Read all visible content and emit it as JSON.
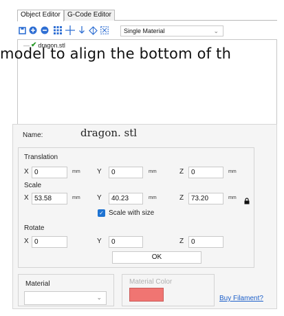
{
  "tabs": [
    {
      "label": "Object Editor",
      "active": true
    },
    {
      "label": "G-Code Editor",
      "active": false
    }
  ],
  "toolbar": {
    "icons": [
      "print-icon",
      "add-icon",
      "remove-icon",
      "grid-icon",
      "move-icon",
      "drop-icon",
      "mirror-icon",
      "split-icon"
    ],
    "material_mode": "Single Material"
  },
  "object_list": {
    "items": [
      {
        "name": "dragon.stl",
        "checked": true
      }
    ]
  },
  "overlay_text": "model to align the bottom of th",
  "properties": {
    "name_label": "Name:",
    "name_value": "dragon. stl",
    "translation": {
      "label": "Translation",
      "x": "0",
      "y": "0",
      "z": "0",
      "unit": "mm"
    },
    "scale": {
      "label": "Scale",
      "x": "53.58",
      "y": "40.23",
      "z": "73.20",
      "unit": "mm",
      "with_size_label": "Scale with size",
      "with_size_checked": true
    },
    "rotate": {
      "label": "Rotate",
      "x": "0",
      "y": "0",
      "z": "0"
    },
    "ok_label": "OK",
    "axes": {
      "x": "X",
      "y": "Y",
      "z": "Z"
    },
    "material": {
      "label": "Material",
      "value": "",
      "color_label": "Material Color",
      "color": "#f07572",
      "buy_link": "Buy Filament?"
    }
  },
  "colors": {
    "accent": "#2f6fd3",
    "link": "#1c5fc9",
    "checkbox": "#1e73d2"
  }
}
